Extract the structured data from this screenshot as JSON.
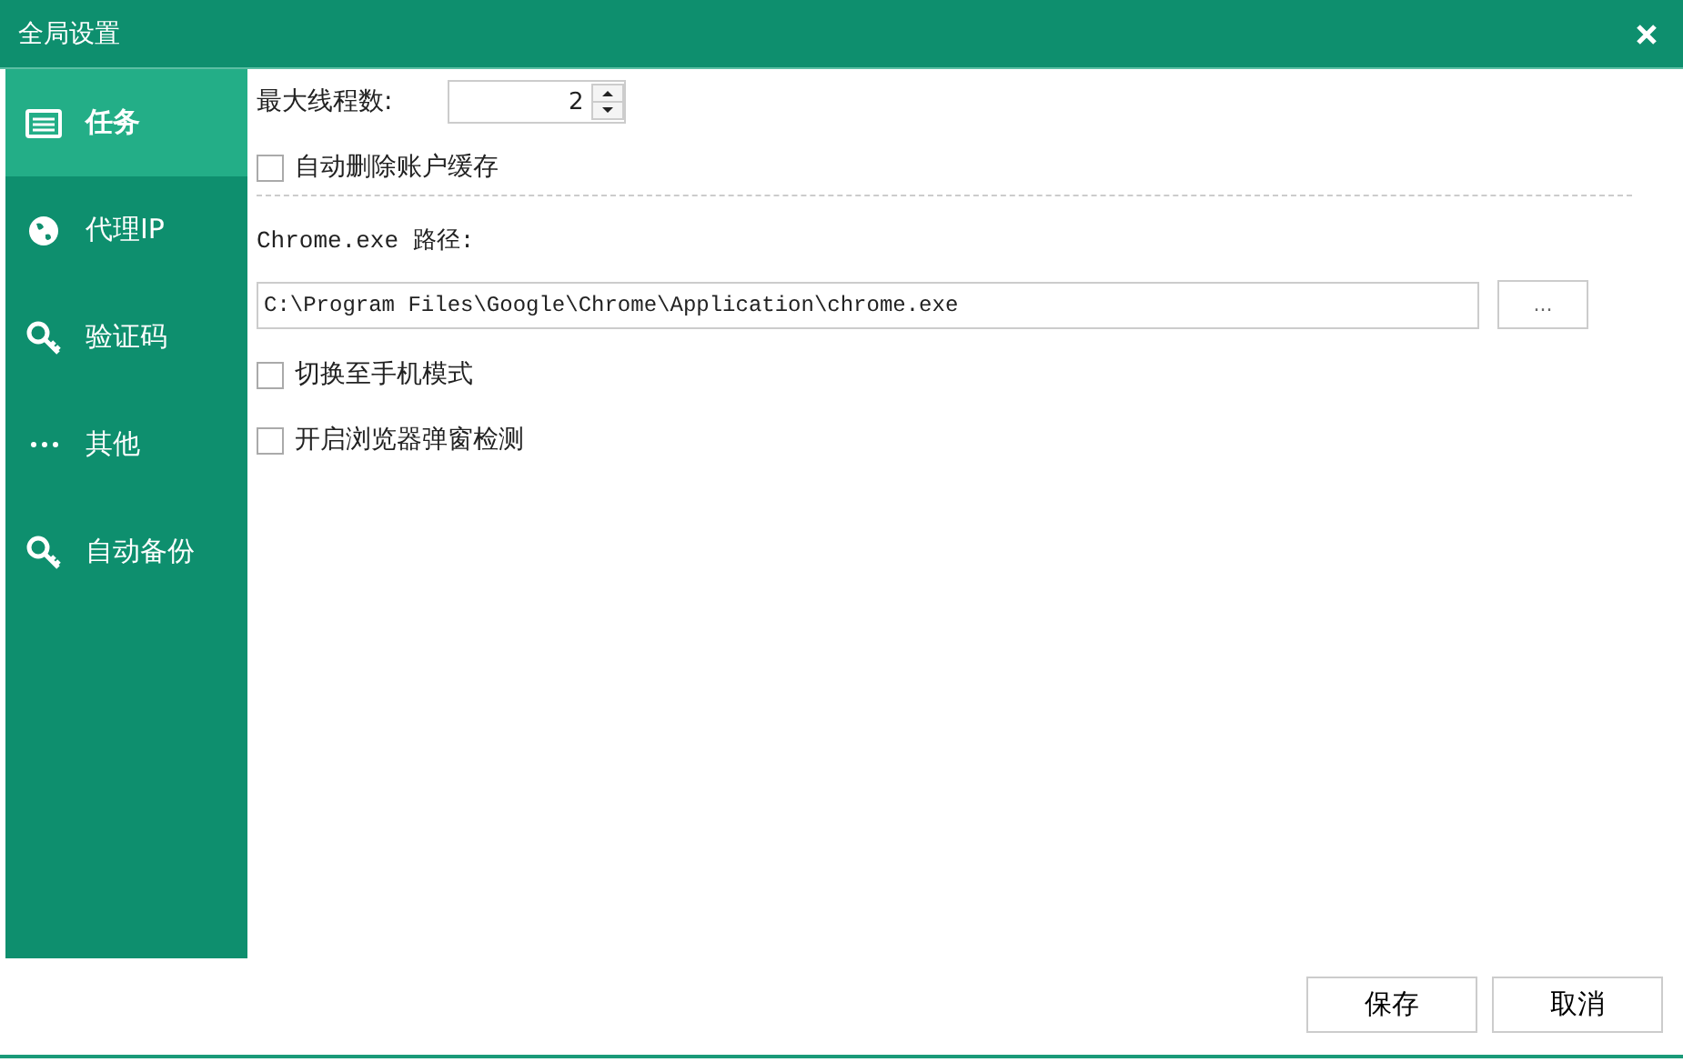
{
  "window": {
    "title": "全局设置"
  },
  "sidebar": {
    "items": [
      {
        "label": "任务",
        "selected": true
      },
      {
        "label": "代理IP",
        "selected": false
      },
      {
        "label": "验证码",
        "selected": false
      },
      {
        "label": "其他",
        "selected": false
      },
      {
        "label": "自动备份",
        "selected": false
      }
    ]
  },
  "settings": {
    "max_threads": {
      "label": "最大线程数:",
      "value": "2"
    },
    "clear_cache": {
      "label": "自动删除账户缓存",
      "checked": false
    },
    "chrome_path": {
      "label": "Chrome.exe 路径:",
      "value": "C:\\Program Files\\Google\\Chrome\\Application\\chrome.exe",
      "browse": "..."
    },
    "options": [
      {
        "label": "切换至手机模式",
        "checked": false
      },
      {
        "label": "开启浏览器弹窗检测",
        "checked": false
      }
    ]
  },
  "buttons": [
    "保存",
    "取消"
  ]
}
